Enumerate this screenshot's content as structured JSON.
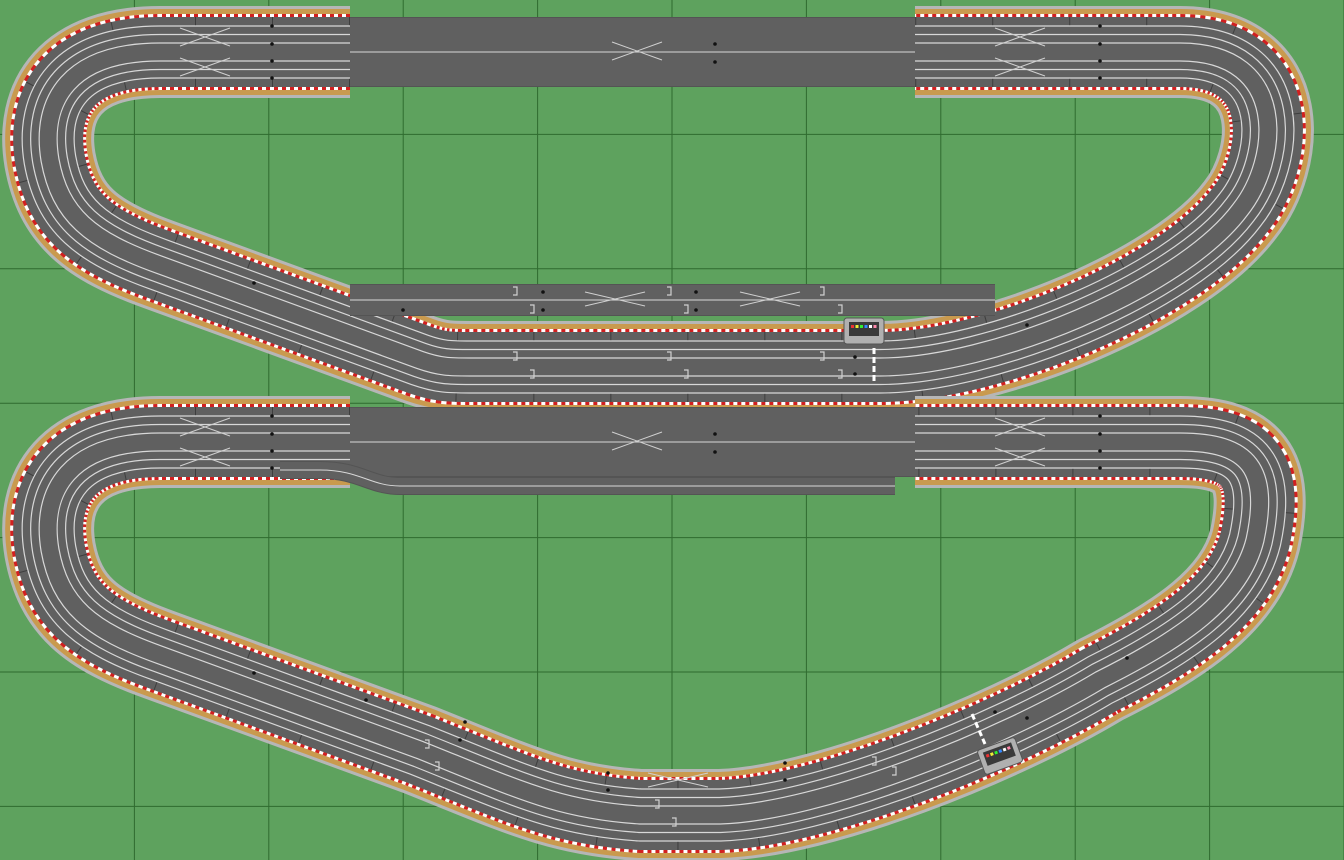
{
  "colors": {
    "grass": "#5ea25e",
    "grid_line": "#2f6b2f",
    "asphalt": "#606060",
    "asphalt_dark": "#545454",
    "lane_line": "#d8d8d8",
    "piece_seam": "#3e3e3e",
    "border_grey": "#b6b6b6",
    "gravel": "#c99a4e",
    "curb_red": "#d22020",
    "curb_white": "#ffffff",
    "crossover": "#d0d0d0",
    "marker": "#111111",
    "start_line": "#ffffff",
    "tower_body": "#b0b0b0",
    "tower_screen": "#3a3a3a"
  },
  "grid": {
    "columns": 10,
    "rows": 6
  },
  "layouts": [
    {
      "id": "upper-layout",
      "lanes": 4,
      "has_pit_lane": true,
      "has_start_finish": true,
      "has_lap_counter": true
    },
    {
      "id": "lower-layout",
      "lanes": 4,
      "has_pit_lane": true,
      "has_start_finish": true,
      "has_lap_counter": true
    }
  ],
  "icons": {
    "lap_counter": "lap-counter-icon",
    "crossover": "lane-change-cross-icon",
    "start_line": "start-finish-line-icon"
  }
}
